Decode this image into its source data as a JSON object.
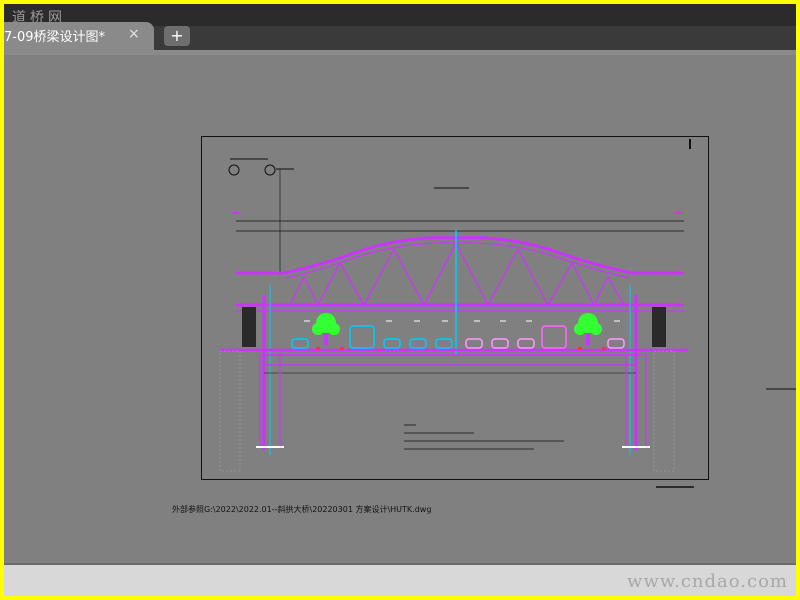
{
  "watermark_top": "道桥网",
  "tab": {
    "title": "7-09桥梁设计图*",
    "close_icon": "×",
    "new_tab_icon": "+"
  },
  "drawing": {
    "path_note": "外部参照G:\\2022\\2022.01--斜拱大桥\\20220301  方案设计\\HUTK.dwg"
  },
  "watermark_bottom": "www.cndao.com",
  "colors": {
    "frame": "#ffff00",
    "tabbar": "#3a3a3a",
    "canvas": "#808080",
    "arch": "#cc33ff",
    "cyan": "#00ccff",
    "tree": "#33ff33"
  }
}
